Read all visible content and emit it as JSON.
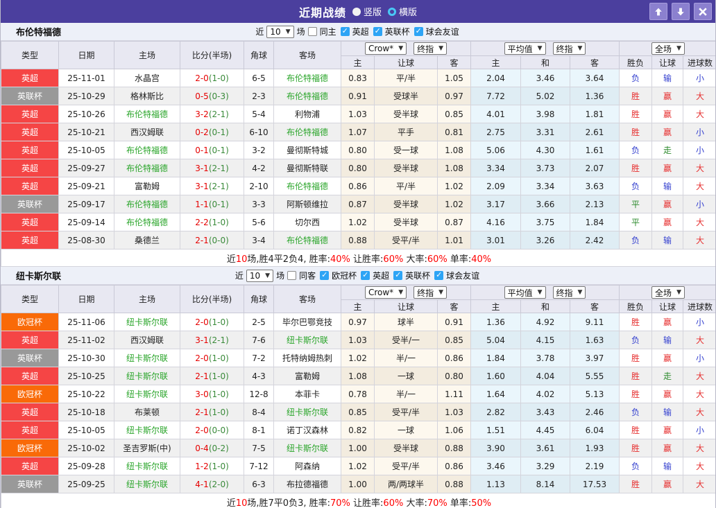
{
  "titlebar": {
    "title": "近期战绩",
    "vertical_label": "竖版",
    "horizontal_label": "横版"
  },
  "colors": {
    "titlebar_bg": "#4b3f9e",
    "epl_badge": "#f54545",
    "efl_badge": "#999999",
    "ucl_badge": "#f96a08",
    "score_red": "#e60000",
    "half_green": "#3a8a3a",
    "team_green": "#2aa52a",
    "result_red": "#e62e2e",
    "result_blue": "#3440cf",
    "result_green": "#2e8b2e",
    "checkbox_blue": "#2da4f5",
    "crow_col_bg": "#fdf8ee",
    "avg_col_bg": "#eaf6fc"
  },
  "header": {
    "col_type": "类型",
    "col_date": "日期",
    "col_home": "主场",
    "col_score": "比分(半场)",
    "col_corner": "角球",
    "col_away": "客场",
    "crow_select": "Crow*",
    "final_select_1": "终指",
    "avg_select": "平均值",
    "final_select_2": "终指",
    "full_select": "全场",
    "sub_cols": [
      "主",
      "让球",
      "客",
      "主",
      "和",
      "客",
      "胜负",
      "让球",
      "进球数"
    ]
  },
  "filter_labels": {
    "near": "近",
    "matches": "场"
  },
  "sections": [
    {
      "team": "布伦特福德",
      "filter": {
        "count": "10",
        "same_venue": {
          "label": "同主",
          "checked": false
        },
        "leagues": [
          {
            "label": "英超",
            "checked": true
          },
          {
            "label": "英联杯",
            "checked": true
          },
          {
            "label": "球会友谊",
            "checked": true
          }
        ]
      },
      "rows": [
        {
          "league": "英超",
          "league_type": "epl",
          "date": "25-11-01",
          "home": "水晶宫",
          "home_is_team": false,
          "score": "2-0",
          "half": "(1-0)",
          "corners": "6-5",
          "away": "布伦特福德",
          "away_is_team": true,
          "odds": [
            "0.83",
            "平/半",
            "1.05"
          ],
          "avg": [
            "2.04",
            "3.46",
            "3.64"
          ],
          "results": [
            "负",
            "输",
            "小"
          ]
        },
        {
          "league": "英联杯",
          "league_type": "efl",
          "date": "25-10-29",
          "home": "格林斯比",
          "home_is_team": false,
          "score": "0-5",
          "half": "(0-3)",
          "corners": "2-3",
          "away": "布伦特福德",
          "away_is_team": true,
          "odds": [
            "0.91",
            "受球半",
            "0.97"
          ],
          "avg": [
            "7.72",
            "5.02",
            "1.36"
          ],
          "results": [
            "胜",
            "赢",
            "大"
          ]
        },
        {
          "league": "英超",
          "league_type": "epl",
          "date": "25-10-26",
          "home": "布伦特福德",
          "home_is_team": true,
          "score": "3-2",
          "half": "(2-1)",
          "corners": "5-4",
          "away": "利物浦",
          "away_is_team": false,
          "odds": [
            "1.03",
            "受半球",
            "0.85"
          ],
          "avg": [
            "4.01",
            "3.98",
            "1.81"
          ],
          "results": [
            "胜",
            "赢",
            "大"
          ]
        },
        {
          "league": "英超",
          "league_type": "epl",
          "date": "25-10-21",
          "home": "西汉姆联",
          "home_is_team": false,
          "score": "0-2",
          "half": "(0-1)",
          "corners": "6-10",
          "away": "布伦特福德",
          "away_is_team": true,
          "odds": [
            "1.07",
            "平手",
            "0.81"
          ],
          "avg": [
            "2.75",
            "3.31",
            "2.61"
          ],
          "results": [
            "胜",
            "赢",
            "小"
          ]
        },
        {
          "league": "英超",
          "league_type": "epl",
          "date": "25-10-05",
          "home": "布伦特福德",
          "home_is_team": true,
          "score": "0-1",
          "half": "(0-1)",
          "corners": "3-2",
          "away": "曼彻斯特城",
          "away_is_team": false,
          "odds": [
            "0.80",
            "受一球",
            "1.08"
          ],
          "avg": [
            "5.06",
            "4.30",
            "1.61"
          ],
          "results": [
            "负",
            "走",
            "小"
          ]
        },
        {
          "league": "英超",
          "league_type": "epl",
          "date": "25-09-27",
          "home": "布伦特福德",
          "home_is_team": true,
          "score": "3-1",
          "half": "(2-1)",
          "corners": "4-2",
          "away": "曼彻斯特联",
          "away_is_team": false,
          "odds": [
            "0.80",
            "受半球",
            "1.08"
          ],
          "avg": [
            "3.34",
            "3.73",
            "2.07"
          ],
          "results": [
            "胜",
            "赢",
            "大"
          ]
        },
        {
          "league": "英超",
          "league_type": "epl",
          "date": "25-09-21",
          "home": "富勒姆",
          "home_is_team": false,
          "score": "3-1",
          "half": "(2-1)",
          "corners": "2-10",
          "away": "布伦特福德",
          "away_is_team": true,
          "odds": [
            "0.86",
            "平/半",
            "1.02"
          ],
          "avg": [
            "2.09",
            "3.34",
            "3.63"
          ],
          "results": [
            "负",
            "输",
            "大"
          ]
        },
        {
          "league": "英联杯",
          "league_type": "efl",
          "date": "25-09-17",
          "home": "布伦特福德",
          "home_is_team": true,
          "score": "1-1",
          "half": "(0-1)",
          "corners": "3-3",
          "away": "阿斯顿维拉",
          "away_is_team": false,
          "odds": [
            "0.87",
            "受半球",
            "1.02"
          ],
          "avg": [
            "3.17",
            "3.66",
            "2.13"
          ],
          "results": [
            "平",
            "赢",
            "小"
          ]
        },
        {
          "league": "英超",
          "league_type": "epl",
          "date": "25-09-14",
          "home": "布伦特福德",
          "home_is_team": true,
          "score": "2-2",
          "half": "(1-0)",
          "corners": "5-6",
          "away": "切尔西",
          "away_is_team": false,
          "odds": [
            "1.02",
            "受半球",
            "0.87"
          ],
          "avg": [
            "4.16",
            "3.75",
            "1.84"
          ],
          "results": [
            "平",
            "赢",
            "大"
          ]
        },
        {
          "league": "英超",
          "league_type": "epl",
          "date": "25-08-30",
          "home": "桑德兰",
          "home_is_team": false,
          "score": "2-1",
          "half": "(0-0)",
          "corners": "3-4",
          "away": "布伦特福德",
          "away_is_team": true,
          "odds": [
            "0.88",
            "受平/半",
            "1.01"
          ],
          "avg": [
            "3.01",
            "3.26",
            "2.42"
          ],
          "results": [
            "负",
            "输",
            "大"
          ]
        }
      ],
      "summary": [
        [
          "近",
          "k"
        ],
        [
          "10",
          "r"
        ],
        [
          "场,胜4平2负4, 胜率:",
          "k"
        ],
        [
          "40%",
          "r"
        ],
        [
          " 让胜率:",
          "k"
        ],
        [
          "60%",
          "r"
        ],
        [
          " 大率:",
          "k"
        ],
        [
          "60%",
          "r"
        ],
        [
          " 单率:",
          "k"
        ],
        [
          "40%",
          "r"
        ]
      ]
    },
    {
      "team": "纽卡斯尔联",
      "filter": {
        "count": "10",
        "same_venue": {
          "label": "同客",
          "checked": false
        },
        "leagues": [
          {
            "label": "欧冠杯",
            "checked": true
          },
          {
            "label": "英超",
            "checked": true
          },
          {
            "label": "英联杯",
            "checked": true
          },
          {
            "label": "球会友谊",
            "checked": true
          }
        ]
      },
      "rows": [
        {
          "league": "欧冠杯",
          "league_type": "ucl",
          "date": "25-11-06",
          "home": "纽卡斯尔联",
          "home_is_team": true,
          "score": "2-0",
          "half": "(1-0)",
          "corners": "2-5",
          "away": "毕尔巴鄂竞技",
          "away_is_team": false,
          "odds": [
            "0.97",
            "球半",
            "0.91"
          ],
          "avg": [
            "1.36",
            "4.92",
            "9.11"
          ],
          "results": [
            "胜",
            "赢",
            "小"
          ]
        },
        {
          "league": "英超",
          "league_type": "epl",
          "date": "25-11-02",
          "home": "西汉姆联",
          "home_is_team": false,
          "score": "3-1",
          "half": "(2-1)",
          "corners": "7-6",
          "away": "纽卡斯尔联",
          "away_is_team": true,
          "odds": [
            "1.03",
            "受半/一",
            "0.85"
          ],
          "avg": [
            "5.04",
            "4.15",
            "1.63"
          ],
          "results": [
            "负",
            "输",
            "大"
          ]
        },
        {
          "league": "英联杯",
          "league_type": "efl",
          "date": "25-10-30",
          "home": "纽卡斯尔联",
          "home_is_team": true,
          "score": "2-0",
          "half": "(1-0)",
          "corners": "7-2",
          "away": "托特纳姆热刺",
          "away_is_team": false,
          "odds": [
            "1.02",
            "半/一",
            "0.86"
          ],
          "avg": [
            "1.84",
            "3.78",
            "3.97"
          ],
          "results": [
            "胜",
            "赢",
            "小"
          ]
        },
        {
          "league": "英超",
          "league_type": "epl",
          "date": "25-10-25",
          "home": "纽卡斯尔联",
          "home_is_team": true,
          "score": "2-1",
          "half": "(1-0)",
          "corners": "4-3",
          "away": "富勒姆",
          "away_is_team": false,
          "odds": [
            "1.08",
            "一球",
            "0.80"
          ],
          "avg": [
            "1.60",
            "4.04",
            "5.55"
          ],
          "results": [
            "胜",
            "走",
            "大"
          ]
        },
        {
          "league": "欧冠杯",
          "league_type": "ucl",
          "date": "25-10-22",
          "home": "纽卡斯尔联",
          "home_is_team": true,
          "score": "3-0",
          "half": "(1-0)",
          "corners": "12-8",
          "away": "本菲卡",
          "away_is_team": false,
          "odds": [
            "0.78",
            "半/一",
            "1.11"
          ],
          "avg": [
            "1.64",
            "4.02",
            "5.13"
          ],
          "results": [
            "胜",
            "赢",
            "大"
          ]
        },
        {
          "league": "英超",
          "league_type": "epl",
          "date": "25-10-18",
          "home": "布莱顿",
          "home_is_team": false,
          "score": "2-1",
          "half": "(1-0)",
          "corners": "8-4",
          "away": "纽卡斯尔联",
          "away_is_team": true,
          "odds": [
            "0.85",
            "受平/半",
            "1.03"
          ],
          "avg": [
            "2.82",
            "3.43",
            "2.46"
          ],
          "results": [
            "负",
            "输",
            "大"
          ]
        },
        {
          "league": "英超",
          "league_type": "epl",
          "date": "25-10-05",
          "home": "纽卡斯尔联",
          "home_is_team": true,
          "score": "2-0",
          "half": "(0-0)",
          "corners": "8-1",
          "away": "诺丁汉森林",
          "away_is_team": false,
          "odds": [
            "0.82",
            "一球",
            "1.06"
          ],
          "avg": [
            "1.51",
            "4.45",
            "6.04"
          ],
          "results": [
            "胜",
            "赢",
            "小"
          ]
        },
        {
          "league": "欧冠杯",
          "league_type": "ucl",
          "date": "25-10-02",
          "home": "圣吉罗斯(中)",
          "home_is_team": false,
          "score": "0-4",
          "half": "(0-2)",
          "corners": "7-5",
          "away": "纽卡斯尔联",
          "away_is_team": true,
          "odds": [
            "1.00",
            "受半球",
            "0.88"
          ],
          "avg": [
            "3.90",
            "3.61",
            "1.93"
          ],
          "results": [
            "胜",
            "赢",
            "大"
          ]
        },
        {
          "league": "英超",
          "league_type": "epl",
          "date": "25-09-28",
          "home": "纽卡斯尔联",
          "home_is_team": true,
          "score": "1-2",
          "half": "(1-0)",
          "corners": "7-12",
          "away": "阿森纳",
          "away_is_team": false,
          "odds": [
            "1.02",
            "受平/半",
            "0.86"
          ],
          "avg": [
            "3.46",
            "3.29",
            "2.19"
          ],
          "results": [
            "负",
            "输",
            "大"
          ]
        },
        {
          "league": "英联杯",
          "league_type": "efl",
          "date": "25-09-25",
          "home": "纽卡斯尔联",
          "home_is_team": true,
          "score": "4-1",
          "half": "(2-0)",
          "corners": "6-3",
          "away": "布拉德福德",
          "away_is_team": false,
          "odds": [
            "1.00",
            "两/两球半",
            "0.88"
          ],
          "avg": [
            "1.13",
            "8.14",
            "17.53"
          ],
          "results": [
            "胜",
            "赢",
            "大"
          ]
        }
      ],
      "summary": [
        [
          "近",
          "k"
        ],
        [
          "10",
          "r"
        ],
        [
          "场,胜7平0负3, 胜率:",
          "k"
        ],
        [
          "70%",
          "r"
        ],
        [
          " 让胜率:",
          "k"
        ],
        [
          "60%",
          "r"
        ],
        [
          " 大率:",
          "k"
        ],
        [
          "70%",
          "r"
        ],
        [
          " 单率:",
          "k"
        ],
        [
          "50%",
          "r"
        ]
      ]
    }
  ]
}
